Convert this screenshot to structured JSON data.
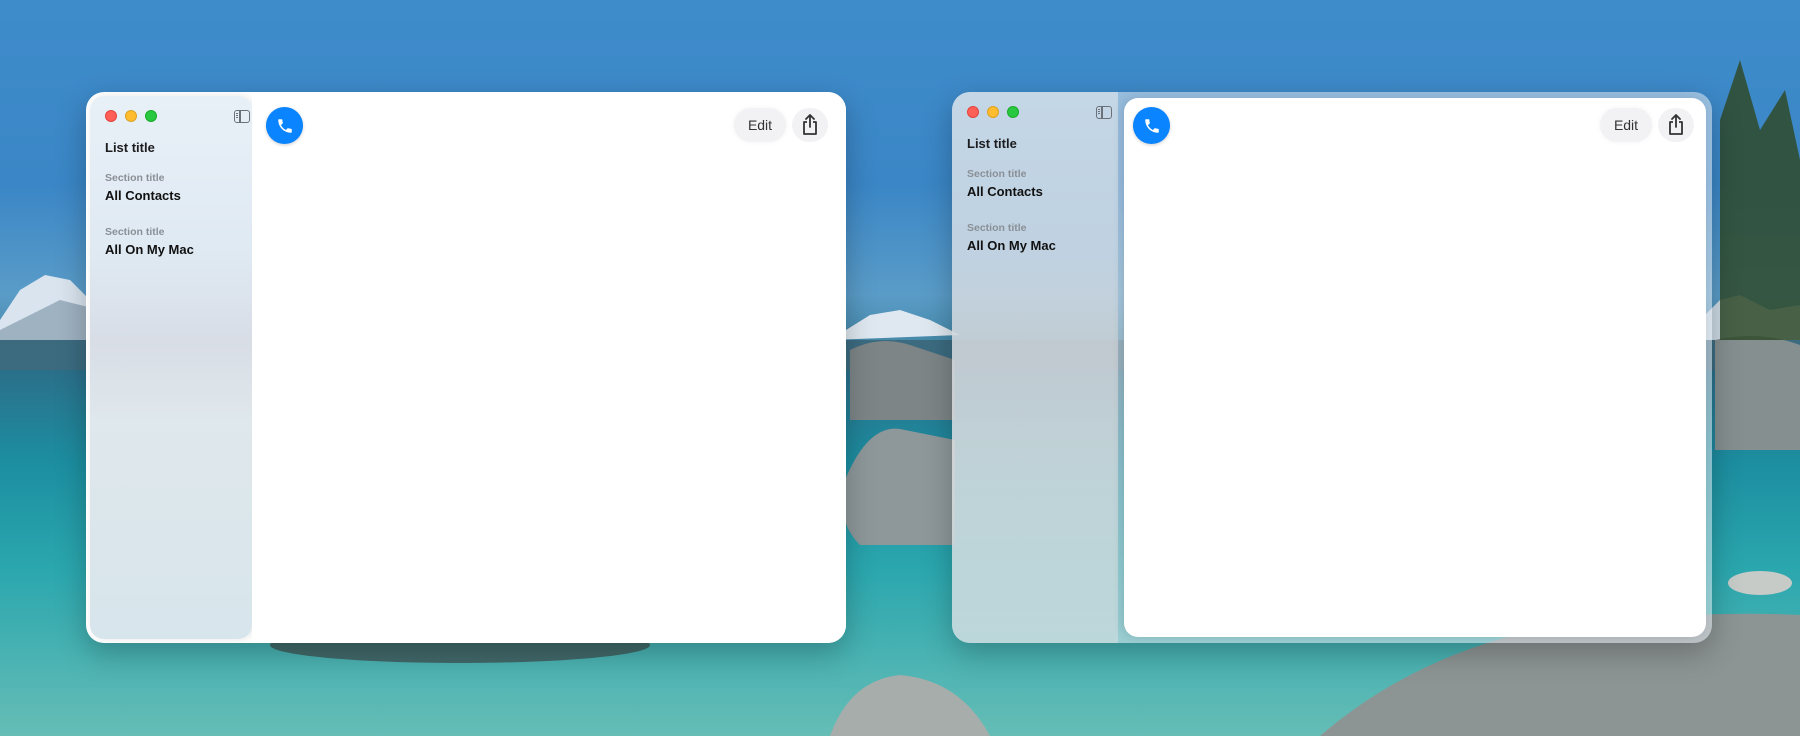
{
  "windows": [
    {
      "id": "left",
      "sidebar": {
        "list_title": "List title",
        "sections": [
          {
            "title": "Section title",
            "item": "All Contacts"
          },
          {
            "title": "Section title",
            "item": "All On My Mac"
          }
        ]
      },
      "toolbar": {
        "edit_label": "Edit",
        "share_icon": "share-icon",
        "call_icon": "phone-icon"
      }
    },
    {
      "id": "right",
      "sidebar": {
        "list_title": "List title",
        "sections": [
          {
            "title": "Section title",
            "item": "All Contacts"
          },
          {
            "title": "Section title",
            "item": "All On My Mac"
          }
        ]
      },
      "toolbar": {
        "edit_label": "Edit",
        "share_icon": "share-icon",
        "call_icon": "phone-icon"
      }
    }
  ],
  "colors": {
    "accent": "#0a84ff",
    "close": "#ff5f57",
    "minimize": "#febc2e",
    "zoom": "#28c840"
  }
}
